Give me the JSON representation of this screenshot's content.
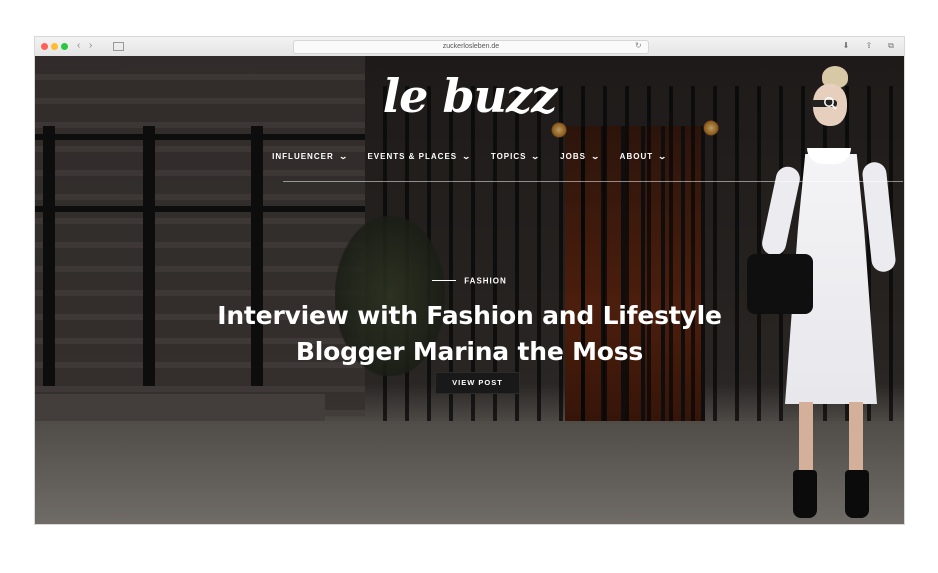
{
  "browser": {
    "url": "zuckerlosleben.de",
    "nav_back": "‹",
    "nav_forward": "›",
    "reload_icon": "↻",
    "download_icon": "⬇",
    "share_icon": "⇪",
    "tabs_icon": "⧉"
  },
  "site": {
    "logo": "le buzz",
    "nav": [
      {
        "label": "INFLUENCER"
      },
      {
        "label": "EVENTS & PLACES"
      },
      {
        "label": "TOPICS"
      },
      {
        "label": "JOBS"
      },
      {
        "label": "ABOUT"
      }
    ]
  },
  "hero": {
    "category": "FASHION",
    "headline_line1": "Interview with Fashion and Lifestyle",
    "headline_line2": "Blogger Marina the Moss",
    "button_label": "VIEW POST"
  },
  "colors": {
    "text": "#ffffff",
    "button_bg": "#1a1919",
    "traffic_red": "#ff5f57",
    "traffic_yellow": "#febc2e",
    "traffic_green": "#28c840"
  }
}
